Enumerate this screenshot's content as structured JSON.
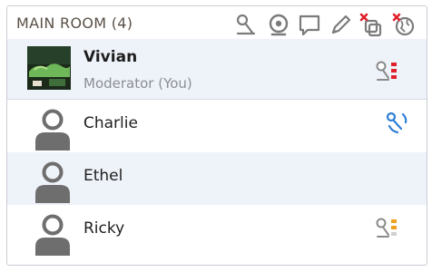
{
  "room": {
    "title": "MAIN ROOM (4)"
  },
  "toolbar": {
    "items": [
      {
        "icon": "microphone-icon"
      },
      {
        "icon": "webcam-icon"
      },
      {
        "icon": "chat-bubble-icon"
      },
      {
        "icon": "pencil-icon"
      },
      {
        "icon": "remove-copy-icon"
      },
      {
        "icon": "remove-globe-icon"
      }
    ]
  },
  "participants": [
    {
      "name": "Vivian",
      "role": "Moderator (You)",
      "avatar": "photo-avatar",
      "status_icon": "microphone-muted-icon",
      "status_color": "#e0202a",
      "highlighted": true
    },
    {
      "name": "Charlie",
      "role": "",
      "avatar": "default-avatar",
      "status_icon": "microphone-talking-icon",
      "status_color": "#2f7fd6",
      "highlighted": false
    },
    {
      "name": "Ethel",
      "role": "",
      "avatar": "default-avatar",
      "status_icon": "",
      "status_color": "",
      "highlighted": true
    },
    {
      "name": "Ricky",
      "role": "",
      "avatar": "default-avatar",
      "status_icon": "microphone-low-icon",
      "status_color": "#f0a020",
      "highlighted": false
    }
  ]
}
